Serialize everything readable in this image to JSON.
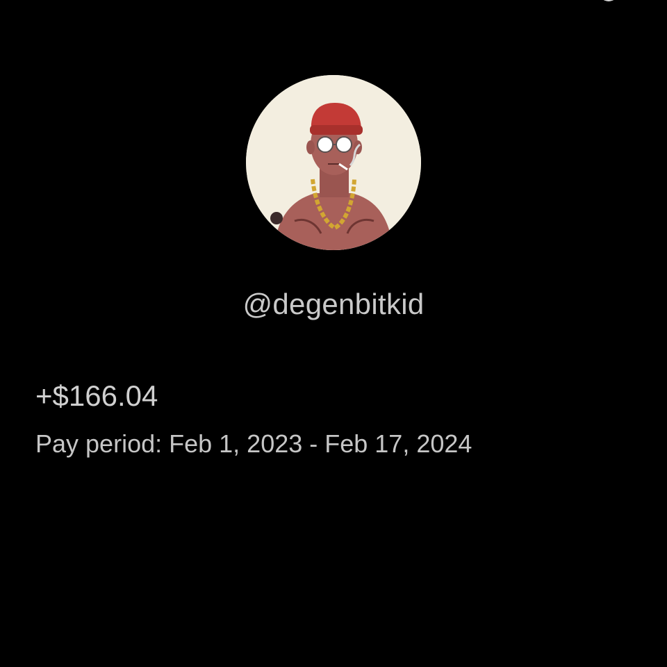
{
  "profile": {
    "avatar_icon": "cartoon-avatar-icon",
    "handle": "@degenbitkid"
  },
  "payout": {
    "amount": "+$166.04",
    "pay_period": "Pay period: Feb 1, 2023 - Feb 17, 2024"
  },
  "colors": {
    "background": "#000000",
    "text": "#c9c9c9",
    "avatar_background": "#f3eee0",
    "beanie": "#c33a36",
    "chain": "#d2a632",
    "skin": "#a8605a"
  }
}
